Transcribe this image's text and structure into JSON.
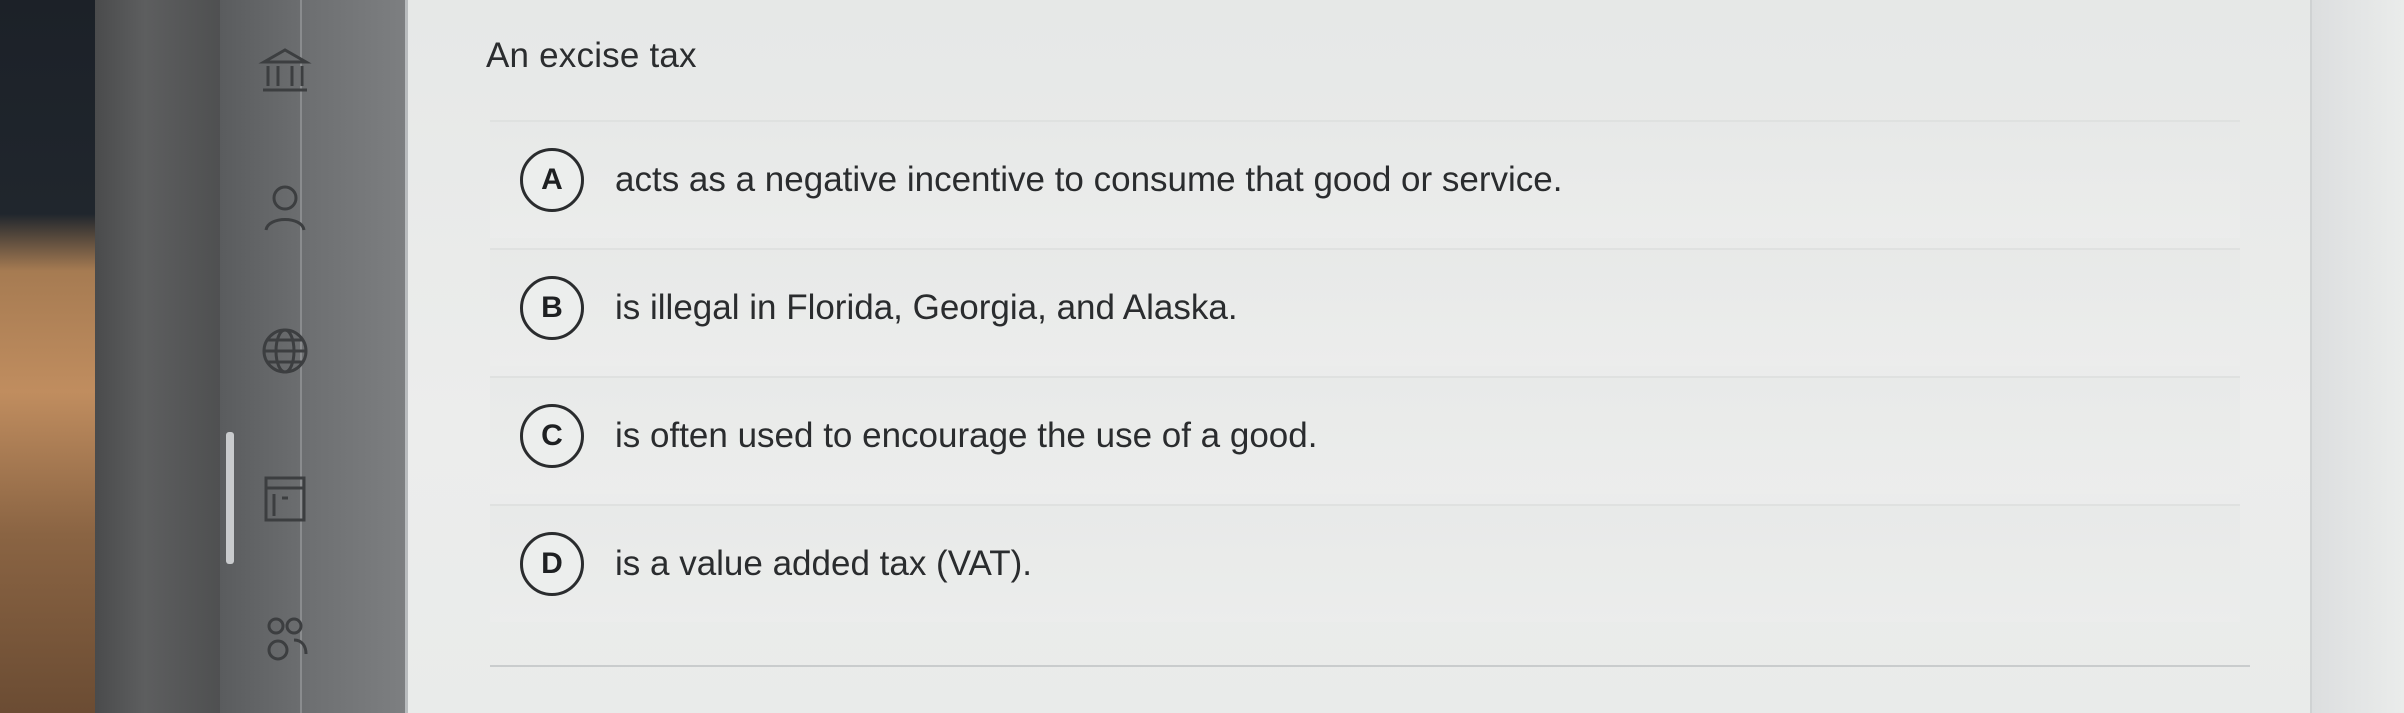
{
  "question": {
    "prompt": "An excise tax"
  },
  "choices": [
    {
      "letter": "A",
      "text": "acts as a negative incentive to consume that good or service."
    },
    {
      "letter": "B",
      "text": "is illegal in Florida, Georgia, and Alaska."
    },
    {
      "letter": "C",
      "text": "is often used to encourage the use of a good."
    },
    {
      "letter": "D",
      "text": "is a value added tax (VAT)."
    }
  ],
  "sidebar": {
    "icons": [
      "bank-icon",
      "user-icon",
      "globe-icon",
      "document-icon",
      "people-icon"
    ]
  },
  "colors": {
    "content_bg": "#e9ebea",
    "rail_bg": "#6e7072",
    "text": "#2a2c2e"
  }
}
